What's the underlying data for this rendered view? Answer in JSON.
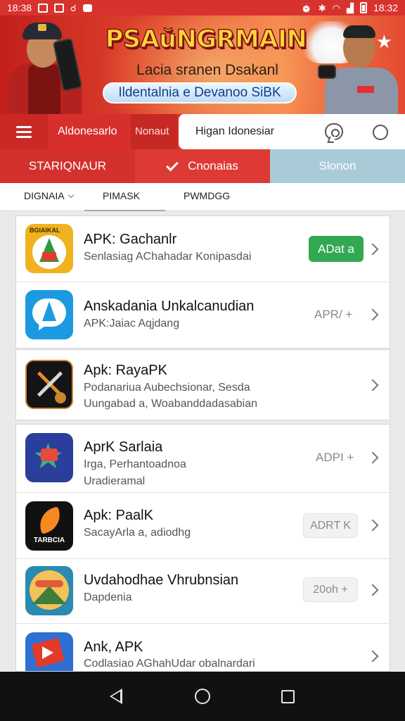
{
  "status_bar": {
    "time": "18:38",
    "time_right": "18:32"
  },
  "banner": {
    "title": "PSAŭNGRMAIN",
    "subtitle": "Lacia sranen Dsakanl",
    "pill_text": "Ildentalnia e Devanoo SiBK"
  },
  "search_row": {
    "location": "Aldonesarlo",
    "sub_location": "Nonaut",
    "search_value": "Higan Idonesiar"
  },
  "tabs": [
    {
      "label": "STARIQNAUR"
    },
    {
      "label": "Cnonaias"
    },
    {
      "label": "Slonon"
    }
  ],
  "subtabs": [
    {
      "label": "DIGNAIA"
    },
    {
      "label": "PIMASK"
    },
    {
      "label": "PWMDGG"
    }
  ],
  "apps": [
    {
      "title": "APK: Gachanlr",
      "subtitle": "Senlasiag AChahadar Konipasdai",
      "subtitle2": "",
      "action": "ADat a",
      "action_style": "green",
      "icon_text": "BGIAIKAL",
      "icon_color": "#f0b21e"
    },
    {
      "title": "Anskadania Unkalcanudian",
      "subtitle": "APK:Jaiac Aqjdang",
      "subtitle2": "",
      "action": "APR/ +",
      "action_style": "text",
      "icon_text": "",
      "icon_color": "#1b9ae0"
    },
    {
      "title": "Apk: RayaPK",
      "subtitle": "Podanariua Aubechsionar, Sesda",
      "subtitle2": "Uungabad a, Woabanddadasabian",
      "action": "",
      "action_style": "none",
      "icon_text": "",
      "icon_color": "#141414"
    },
    {
      "title": "AprK Sarlaia",
      "subtitle": "Irga, Perhantoadnoa",
      "subtitle2": "Uradieramal",
      "action": "ADPI +",
      "action_style": "text",
      "icon_text": "",
      "icon_color": "#2a3f9b"
    },
    {
      "title": "Apk: PaalK",
      "subtitle": "SacayArla a, adiodhg",
      "subtitle2": "",
      "action": "ADRT K",
      "action_style": "gray",
      "icon_text": "TARBCIA",
      "icon_color": "#111111"
    },
    {
      "title": "Uvdahodhae Vhrubnsian",
      "subtitle": "Dapdenia",
      "subtitle2": "",
      "action": "20oh +",
      "action_style": "gray",
      "icon_text": "",
      "icon_color": "#2a8ab1"
    },
    {
      "title": "Ank, APK",
      "subtitle": "Codlasiao AGhahUdar obalnardari",
      "subtitle2": "",
      "action": "",
      "action_style": "none",
      "icon_text": "",
      "icon_color": "#2e6fd3"
    }
  ],
  "colors": {
    "brand_red": "#d7302c",
    "accent_green": "#33a852",
    "tab_teal": "#a9cbd8"
  }
}
